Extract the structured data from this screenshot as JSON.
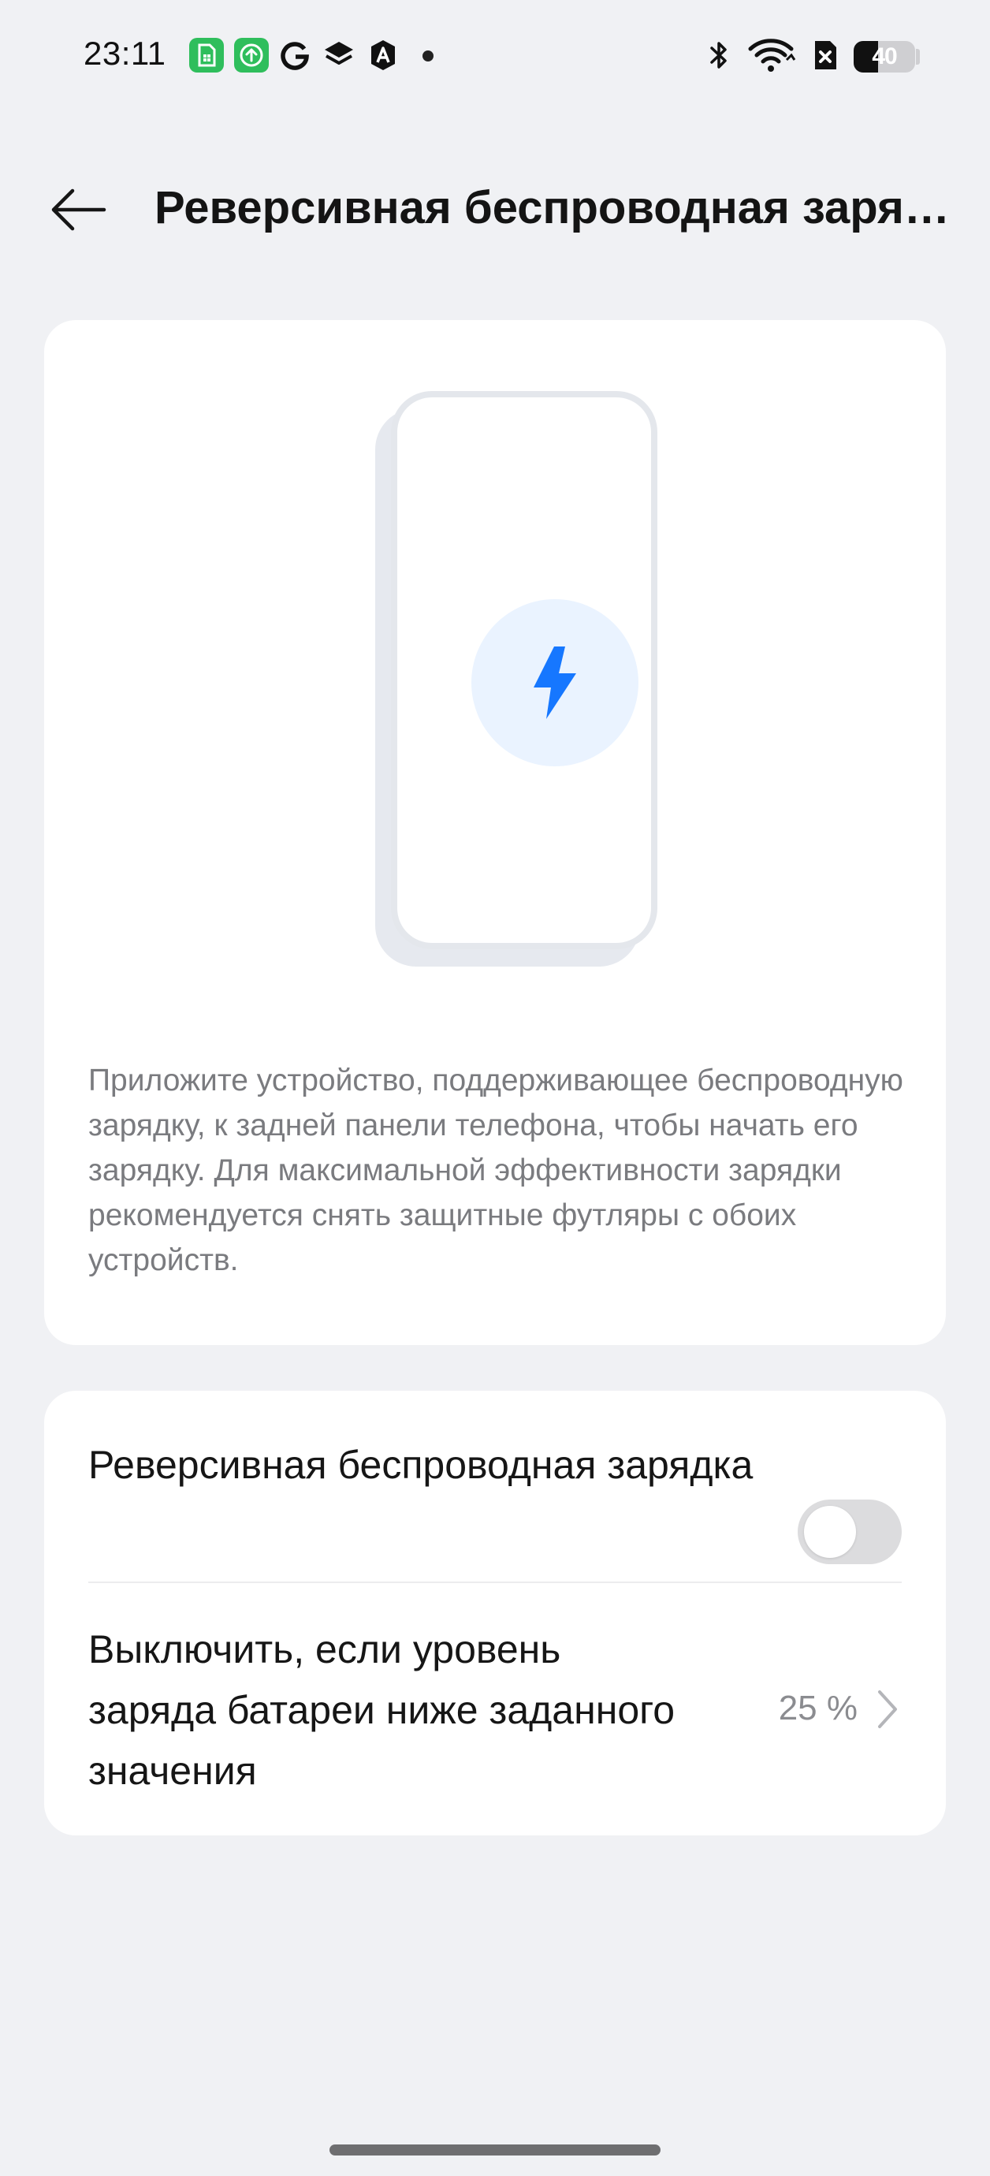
{
  "status_bar": {
    "time": "23:11",
    "battery_level": "40",
    "battery_fraction": 0.4,
    "icons": [
      "sim-app-icon",
      "upload-app-icon",
      "google-icon",
      "layers-icon",
      "autonomous-app-icon",
      "notification-dot",
      "bluetooth-icon",
      "wifi-icon",
      "no-signal-sim-icon",
      "battery-icon"
    ]
  },
  "header": {
    "back_icon": "arrow-left-icon",
    "title": "Реверсивная беспроводная зарядка"
  },
  "hero": {
    "illustration_icon": "lightning-bolt-icon",
    "accent_color": "#1677ff",
    "description": "Приложите устройство, поддерживающее беспроводную зарядку, к задней панели телефона, чтобы начать его зарядку. Для максимальной эффективности зарядки рекомендуется снять защитные футляры с обоих устройств."
  },
  "settings": {
    "reverse_charging": {
      "label": "Реверсивная беспроводная зарядка",
      "enabled": false
    },
    "threshold": {
      "label": "Выключить, если уровень заряда батареи ниже заданного значения",
      "value": "25 %",
      "icon": "chevron-right-icon"
    }
  }
}
